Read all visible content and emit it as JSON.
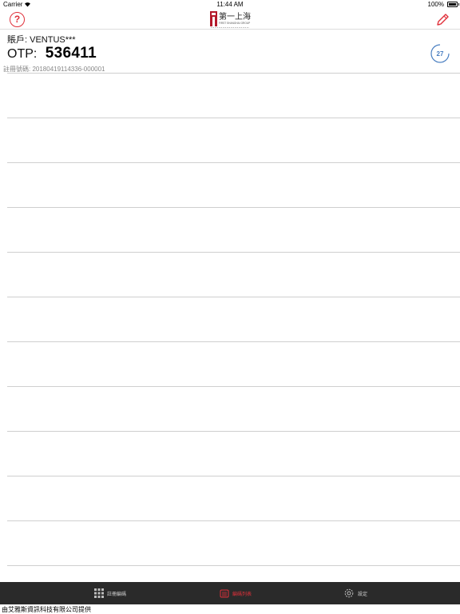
{
  "status_bar": {
    "carrier": "Carrier",
    "time": "11:44 AM",
    "battery": "100%",
    "battery_level": 1.0
  },
  "navbar": {
    "logo_text": "第一上海",
    "logo_subtext": "FIRST SHANGHAI GROUP"
  },
  "account": {
    "label": "賬戶: VENTUS***"
  },
  "otp": {
    "label": "OTP:",
    "code": "536411",
    "countdown": "27"
  },
  "registration": {
    "text": "註冊號碼: 20180419114336-000001"
  },
  "list_rows": 11,
  "tabs": [
    {
      "label": "註冊編碼",
      "icon": "grid-icon",
      "active": false
    },
    {
      "label": "編碼列表",
      "icon": "list-icon",
      "active": true
    },
    {
      "label": "設定",
      "icon": "gear-icon",
      "active": false
    }
  ],
  "footer": {
    "text": "由艾雅斯資訊科技有限公司提供"
  },
  "colors": {
    "accent": "#e0303a",
    "timer": "#4a7fc1",
    "tabbar_bg": "#2a2a2a"
  }
}
